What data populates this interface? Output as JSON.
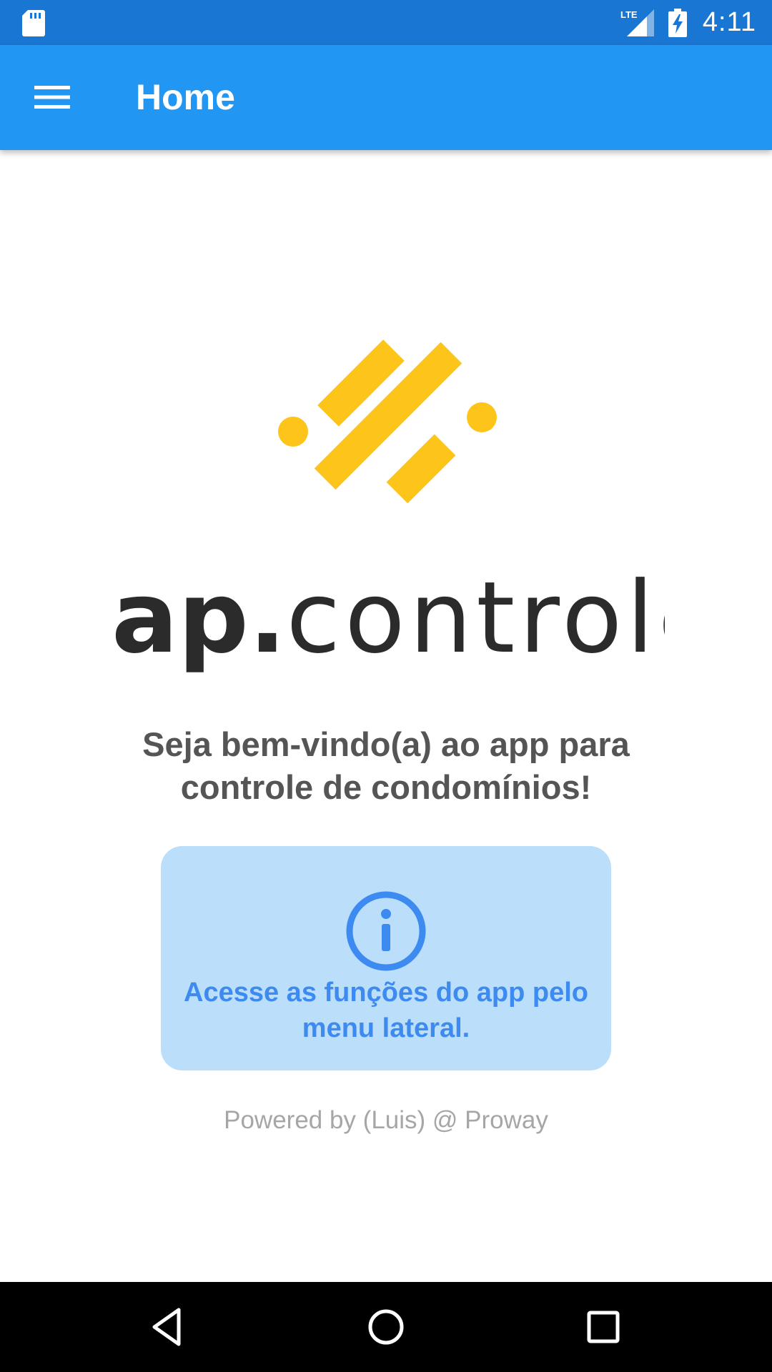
{
  "status_bar": {
    "time": "4:11",
    "network": "LTE",
    "icons": [
      "sd-card-icon",
      "lte-signal-icon",
      "battery-charging-icon"
    ]
  },
  "app_bar": {
    "title": "Home",
    "menu_icon": "hamburger-menu-icon"
  },
  "logo": {
    "wordmark_bold": "ap.",
    "wordmark_light": "controle",
    "mark_color": "#fdc41a",
    "text_color": "#2b2b2b"
  },
  "main": {
    "welcome_text": "Seja bem-vindo(a) ao app para\ncontrole de condomínios!",
    "info_card": {
      "icon": "info-circle-icon",
      "text": "Acesse as funções do app pelo\nmenu lateral."
    },
    "footer": "Powered by (Luis) @ Proway"
  },
  "nav_bar": {
    "buttons": [
      "back-icon",
      "home-icon",
      "recents-icon"
    ]
  },
  "colors": {
    "status_bar": "#1976d2",
    "app_bar": "#2196f3",
    "info_card_bg": "#bbdefb",
    "info_accent": "#3d8af0"
  }
}
